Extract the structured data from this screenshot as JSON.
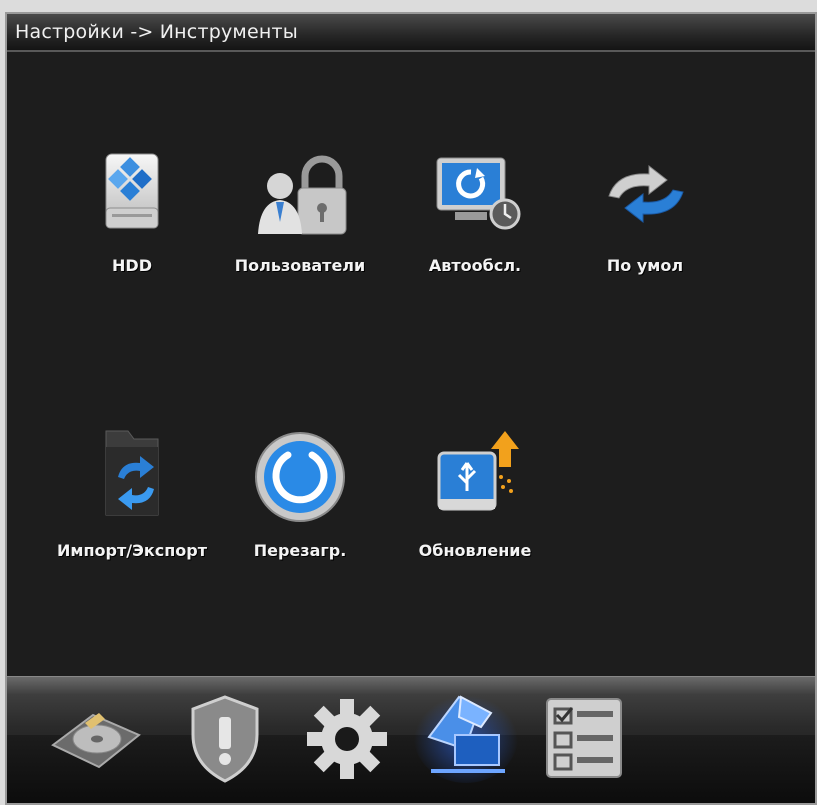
{
  "window": {
    "title": "Настройки -> Инструменты"
  },
  "tools": [
    {
      "id": "hdd",
      "label": "HDD",
      "icon": "hdd-icon"
    },
    {
      "id": "users",
      "label": "Пользователи",
      "icon": "users-lock-icon"
    },
    {
      "id": "auto-maintain",
      "label": "Автообсл.",
      "icon": "auto-maintain-icon"
    },
    {
      "id": "defaults",
      "label": "По умол",
      "icon": "restore-defaults-icon"
    },
    {
      "id": "import-export",
      "label": "Импорт/Экспорт",
      "icon": "import-export-icon"
    },
    {
      "id": "reboot",
      "label": "Перезагр.",
      "icon": "power-icon"
    },
    {
      "id": "upgrade",
      "label": "Обновление",
      "icon": "usb-upgrade-icon"
    }
  ],
  "bottom_nav": [
    {
      "id": "record",
      "icon": "disk-icon",
      "active": false
    },
    {
      "id": "alarm",
      "icon": "shield-alert-icon",
      "active": false
    },
    {
      "id": "system",
      "icon": "gear-icon",
      "active": false
    },
    {
      "id": "tools",
      "icon": "tools-icon",
      "active": true
    },
    {
      "id": "info",
      "icon": "checklist-icon",
      "active": false
    }
  ],
  "colors": {
    "background": "#1d1d1d",
    "label": "#f4f4f4",
    "accent_blue": "#2a7fd6",
    "active_glow": "#2f6fff"
  }
}
